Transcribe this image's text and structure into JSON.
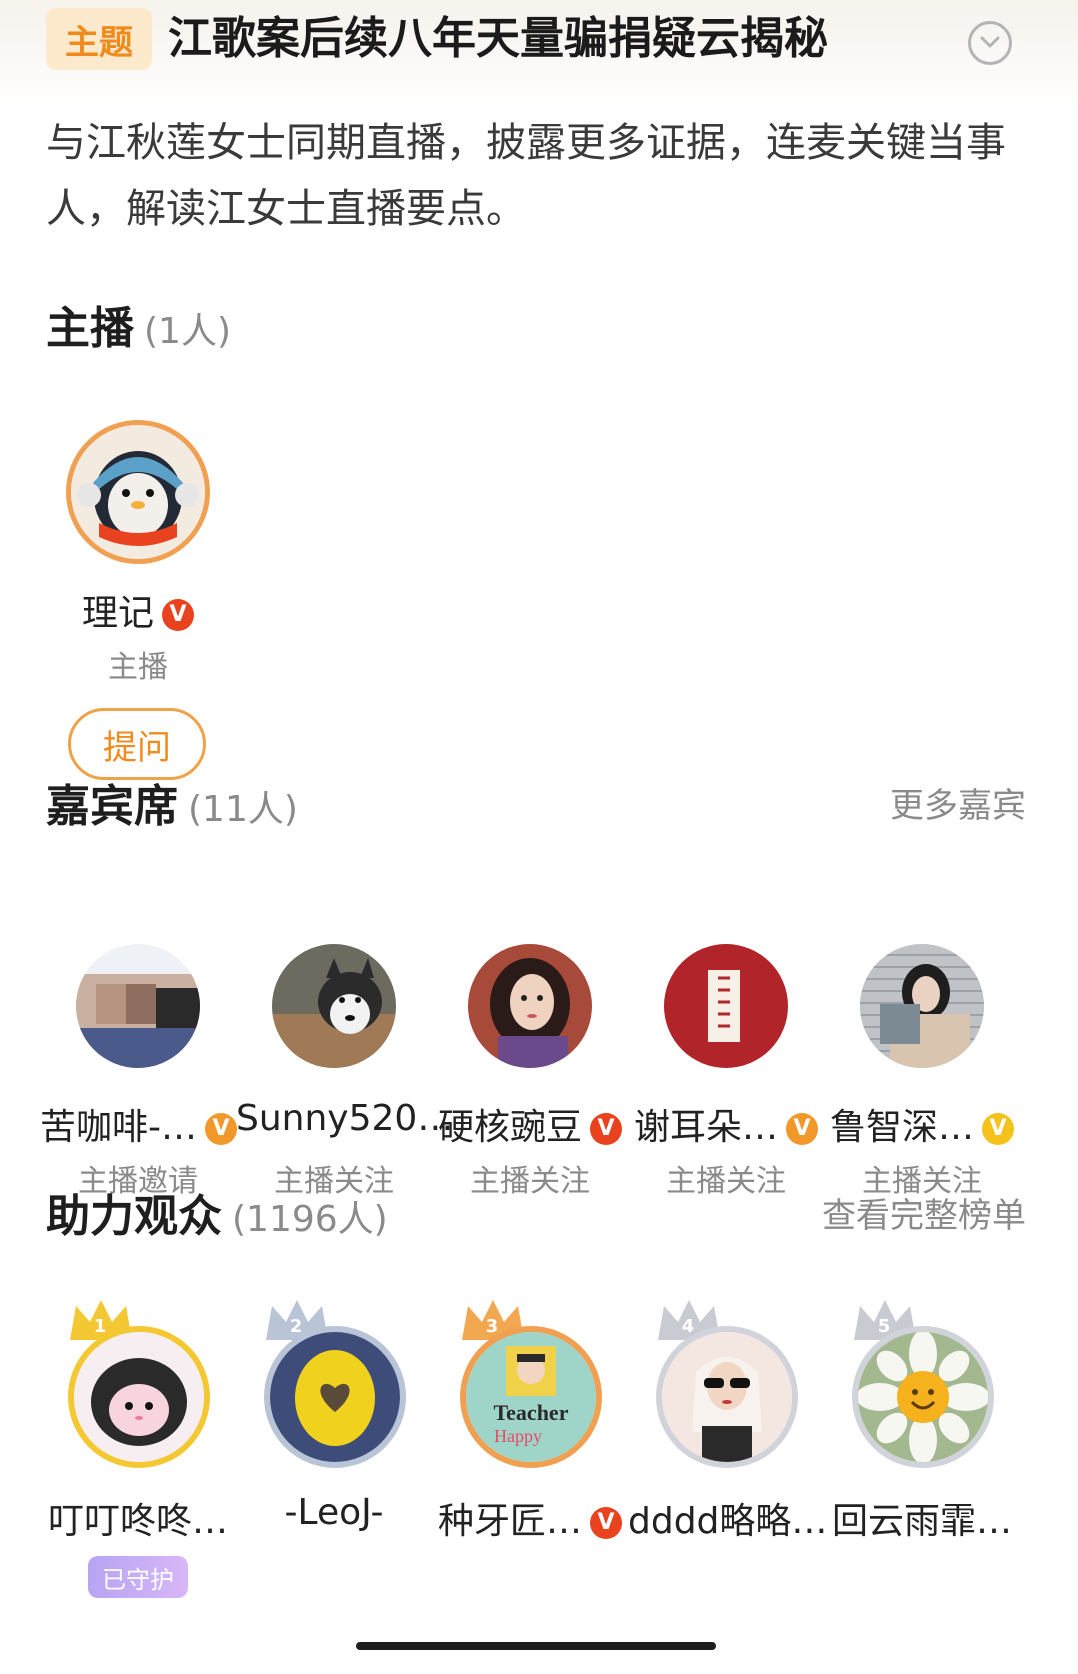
{
  "header": {
    "badge": "主题",
    "title": "江歌案后续八年天量骗捐疑云揭秘",
    "description": "与江秋莲女士同期直播，披露更多证据，连麦关键当事人，解读江女士直播要点。"
  },
  "host_section": {
    "title": "主播",
    "count": "(1人)",
    "host": {
      "name": "理记",
      "role": "主播",
      "verified": "V"
    },
    "ask_button": "提问"
  },
  "guest_section": {
    "title": "嘉宾席",
    "count": "(11人)",
    "more_link": "更多嘉宾",
    "guests": [
      {
        "name": "苦咖啡-…",
        "sub": "主播邀请",
        "badge": "V"
      },
      {
        "name": "Sunny520…",
        "sub": "主播关注"
      },
      {
        "name": "硬核豌豆",
        "sub": "主播关注",
        "badge": "V"
      },
      {
        "name": "谢耳朵…",
        "sub": "主播关注",
        "badge": "V"
      },
      {
        "name": "鲁智深…",
        "sub": "主播关注",
        "badge": "V"
      }
    ]
  },
  "audience_section": {
    "title": "助力观众",
    "count": "(1196人)",
    "ranking_link": "查看完整榜单",
    "audience": [
      {
        "rank": "1",
        "name": "叮叮咚咚…",
        "tag": "已守护"
      },
      {
        "rank": "2",
        "name": "-LeoJ-"
      },
      {
        "rank": "3",
        "name": "种牙匠…",
        "badge": "V"
      },
      {
        "rank": "4",
        "name": "dddd略略…"
      },
      {
        "rank": "5",
        "name": "回云雨霏…"
      }
    ]
  },
  "colors": {
    "accent_orange": "#f08a1c",
    "verified_red": "#e8431e",
    "verified_orange": "#f2982a",
    "verified_yellow": "#f5c21c",
    "gold_ring": "#f4c832",
    "silver_ring": "#b9c4d6",
    "bronze_ring": "#f0a050",
    "guard_purple": "#b7a4f4"
  }
}
